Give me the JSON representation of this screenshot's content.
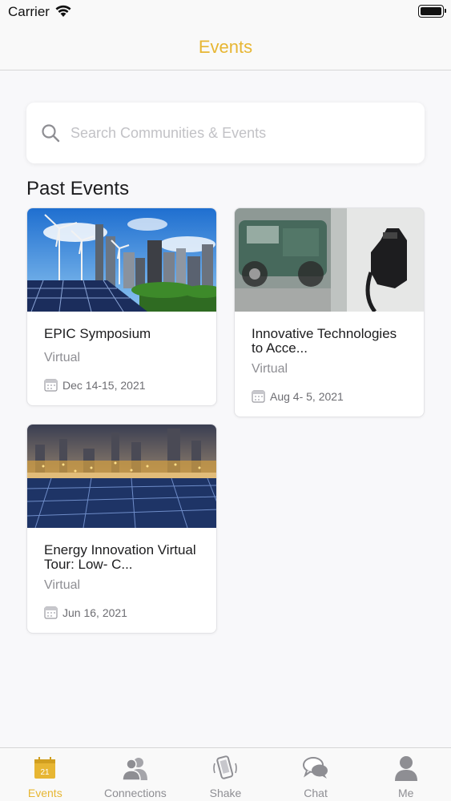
{
  "status_bar": {
    "carrier": "Carrier"
  },
  "nav": {
    "title": "Events"
  },
  "search": {
    "placeholder": "Search Communities & Events",
    "value": ""
  },
  "section": {
    "title": "Past Events"
  },
  "events": [
    {
      "title": "EPIC Symposium",
      "location": "Virtual",
      "date": "Dec 14-15, 2021"
    },
    {
      "title": "Innovative Technologies to Acce...",
      "location": "Virtual",
      "date": "Aug  4- 5, 2021"
    },
    {
      "title": "Energy Innovation Virtual Tour: Low- C...",
      "location": "Virtual",
      "date": "Jun 16, 2021"
    }
  ],
  "tabs": [
    {
      "label": "Events",
      "icon": "calendar-icon",
      "badge": "21",
      "active": true
    },
    {
      "label": "Connections",
      "icon": "people-icon",
      "active": false
    },
    {
      "label": "Shake",
      "icon": "shake-phone-icon",
      "active": false
    },
    {
      "label": "Chat",
      "icon": "chat-bubbles-icon",
      "active": false
    },
    {
      "label": "Me",
      "icon": "person-icon",
      "active": false
    }
  ],
  "colors": {
    "accent": "#e7b633",
    "inactive": "#8e8e93",
    "background": "#f8f8fa"
  }
}
